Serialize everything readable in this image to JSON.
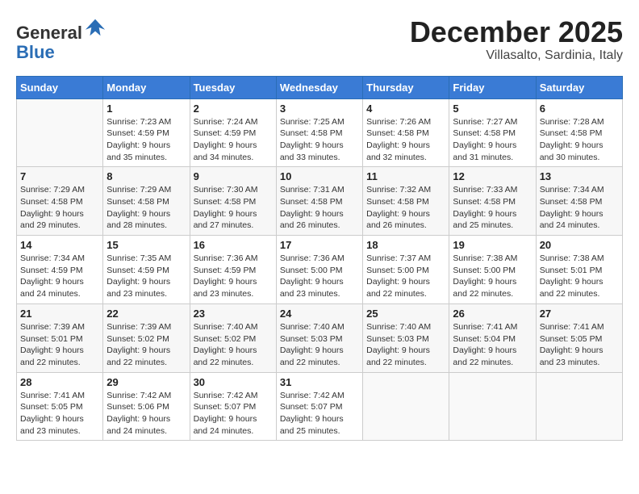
{
  "header": {
    "logo_line1": "General",
    "logo_line2": "Blue",
    "month": "December 2025",
    "location": "Villasalto, Sardinia, Italy"
  },
  "weekdays": [
    "Sunday",
    "Monday",
    "Tuesday",
    "Wednesday",
    "Thursday",
    "Friday",
    "Saturday"
  ],
  "weeks": [
    [
      {
        "day": "",
        "info": ""
      },
      {
        "day": "1",
        "info": "Sunrise: 7:23 AM\nSunset: 4:59 PM\nDaylight: 9 hours\nand 35 minutes."
      },
      {
        "day": "2",
        "info": "Sunrise: 7:24 AM\nSunset: 4:59 PM\nDaylight: 9 hours\nand 34 minutes."
      },
      {
        "day": "3",
        "info": "Sunrise: 7:25 AM\nSunset: 4:58 PM\nDaylight: 9 hours\nand 33 minutes."
      },
      {
        "day": "4",
        "info": "Sunrise: 7:26 AM\nSunset: 4:58 PM\nDaylight: 9 hours\nand 32 minutes."
      },
      {
        "day": "5",
        "info": "Sunrise: 7:27 AM\nSunset: 4:58 PM\nDaylight: 9 hours\nand 31 minutes."
      },
      {
        "day": "6",
        "info": "Sunrise: 7:28 AM\nSunset: 4:58 PM\nDaylight: 9 hours\nand 30 minutes."
      }
    ],
    [
      {
        "day": "7",
        "info": "Sunrise: 7:29 AM\nSunset: 4:58 PM\nDaylight: 9 hours\nand 29 minutes."
      },
      {
        "day": "8",
        "info": "Sunrise: 7:29 AM\nSunset: 4:58 PM\nDaylight: 9 hours\nand 28 minutes."
      },
      {
        "day": "9",
        "info": "Sunrise: 7:30 AM\nSunset: 4:58 PM\nDaylight: 9 hours\nand 27 minutes."
      },
      {
        "day": "10",
        "info": "Sunrise: 7:31 AM\nSunset: 4:58 PM\nDaylight: 9 hours\nand 26 minutes."
      },
      {
        "day": "11",
        "info": "Sunrise: 7:32 AM\nSunset: 4:58 PM\nDaylight: 9 hours\nand 26 minutes."
      },
      {
        "day": "12",
        "info": "Sunrise: 7:33 AM\nSunset: 4:58 PM\nDaylight: 9 hours\nand 25 minutes."
      },
      {
        "day": "13",
        "info": "Sunrise: 7:34 AM\nSunset: 4:58 PM\nDaylight: 9 hours\nand 24 minutes."
      }
    ],
    [
      {
        "day": "14",
        "info": "Sunrise: 7:34 AM\nSunset: 4:59 PM\nDaylight: 9 hours\nand 24 minutes."
      },
      {
        "day": "15",
        "info": "Sunrise: 7:35 AM\nSunset: 4:59 PM\nDaylight: 9 hours\nand 23 minutes."
      },
      {
        "day": "16",
        "info": "Sunrise: 7:36 AM\nSunset: 4:59 PM\nDaylight: 9 hours\nand 23 minutes."
      },
      {
        "day": "17",
        "info": "Sunrise: 7:36 AM\nSunset: 5:00 PM\nDaylight: 9 hours\nand 23 minutes."
      },
      {
        "day": "18",
        "info": "Sunrise: 7:37 AM\nSunset: 5:00 PM\nDaylight: 9 hours\nand 22 minutes."
      },
      {
        "day": "19",
        "info": "Sunrise: 7:38 AM\nSunset: 5:00 PM\nDaylight: 9 hours\nand 22 minutes."
      },
      {
        "day": "20",
        "info": "Sunrise: 7:38 AM\nSunset: 5:01 PM\nDaylight: 9 hours\nand 22 minutes."
      }
    ],
    [
      {
        "day": "21",
        "info": "Sunrise: 7:39 AM\nSunset: 5:01 PM\nDaylight: 9 hours\nand 22 minutes."
      },
      {
        "day": "22",
        "info": "Sunrise: 7:39 AM\nSunset: 5:02 PM\nDaylight: 9 hours\nand 22 minutes."
      },
      {
        "day": "23",
        "info": "Sunrise: 7:40 AM\nSunset: 5:02 PM\nDaylight: 9 hours\nand 22 minutes."
      },
      {
        "day": "24",
        "info": "Sunrise: 7:40 AM\nSunset: 5:03 PM\nDaylight: 9 hours\nand 22 minutes."
      },
      {
        "day": "25",
        "info": "Sunrise: 7:40 AM\nSunset: 5:03 PM\nDaylight: 9 hours\nand 22 minutes."
      },
      {
        "day": "26",
        "info": "Sunrise: 7:41 AM\nSunset: 5:04 PM\nDaylight: 9 hours\nand 22 minutes."
      },
      {
        "day": "27",
        "info": "Sunrise: 7:41 AM\nSunset: 5:05 PM\nDaylight: 9 hours\nand 23 minutes."
      }
    ],
    [
      {
        "day": "28",
        "info": "Sunrise: 7:41 AM\nSunset: 5:05 PM\nDaylight: 9 hours\nand 23 minutes."
      },
      {
        "day": "29",
        "info": "Sunrise: 7:42 AM\nSunset: 5:06 PM\nDaylight: 9 hours\nand 24 minutes."
      },
      {
        "day": "30",
        "info": "Sunrise: 7:42 AM\nSunset: 5:07 PM\nDaylight: 9 hours\nand 24 minutes."
      },
      {
        "day": "31",
        "info": "Sunrise: 7:42 AM\nSunset: 5:07 PM\nDaylight: 9 hours\nand 25 minutes."
      },
      {
        "day": "",
        "info": ""
      },
      {
        "day": "",
        "info": ""
      },
      {
        "day": "",
        "info": ""
      }
    ]
  ]
}
